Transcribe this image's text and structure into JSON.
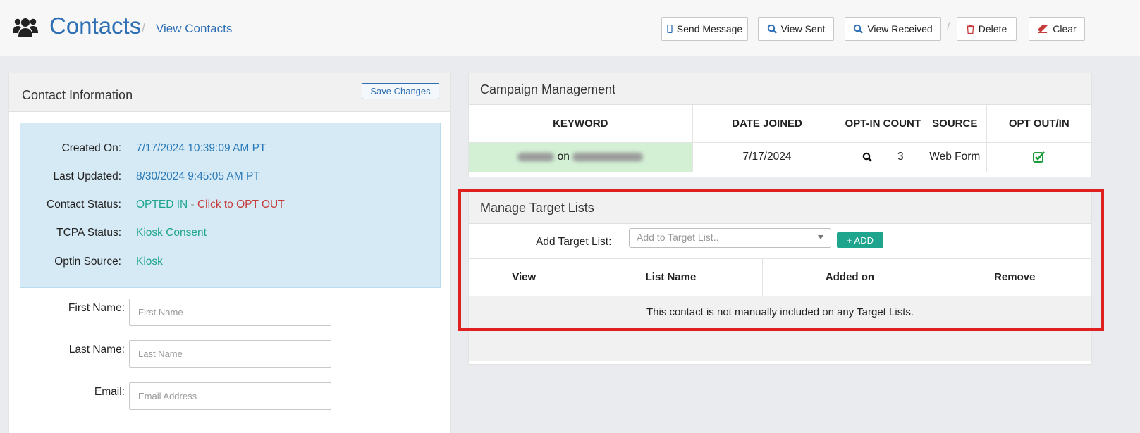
{
  "header": {
    "title": "Contacts",
    "separator": "/",
    "breadcrumb": "View Contacts",
    "buttons": {
      "send_message": "Send Message",
      "view_sent": "View Sent",
      "view_received": "View Received",
      "delete": "Delete",
      "clear": "Clear"
    },
    "slash": "/"
  },
  "contact_info": {
    "title": "Contact Information",
    "save_label": "Save Changes",
    "details": {
      "created_label": "Created On:",
      "created_value": "7/17/2024 10:39:09 AM PT",
      "updated_label": "Last Updated:",
      "updated_value": "8/30/2024 9:45:05 AM PT",
      "status_label": "Contact Status:",
      "status_value": "OPTED IN",
      "status_dash": " - ",
      "status_link": "Click to OPT OUT",
      "tcpa_label": "TCPA Status:",
      "tcpa_value": "Kiosk Consent",
      "optin_label": "Optin Source:",
      "optin_value": "Kiosk"
    },
    "fields": {
      "first_name_label": "First Name:",
      "first_name_placeholder": "First Name",
      "last_name_label": "Last Name:",
      "last_name_placeholder": "Last Name",
      "email_label": "Email:",
      "email_placeholder": "Email Address"
    }
  },
  "campaign": {
    "title": "Campaign Management",
    "columns": [
      "KEYWORD",
      "DATE JOINED",
      "OPT-IN COUNT",
      "SOURCE",
      "OPT OUT/IN"
    ],
    "row": {
      "keyword_on": "on",
      "date_joined": "7/17/2024",
      "optin_count": "3",
      "source": "Web Form",
      "opt_status": "checked"
    }
  },
  "target_lists": {
    "title": "Manage Target Lists",
    "add_label": "Add Target List:",
    "select_placeholder": "Add to Target List..",
    "add_button": "+ ADD",
    "columns": [
      "View",
      "List Name",
      "Added on",
      "Remove"
    ],
    "empty_message": "This contact is not manually included on any Target Lists."
  },
  "colors": {
    "brand_blue": "#2f6fb3",
    "accent_green": "#1fa58e",
    "alert_red": "#c63a3a",
    "highlight_red": "#e02020"
  }
}
